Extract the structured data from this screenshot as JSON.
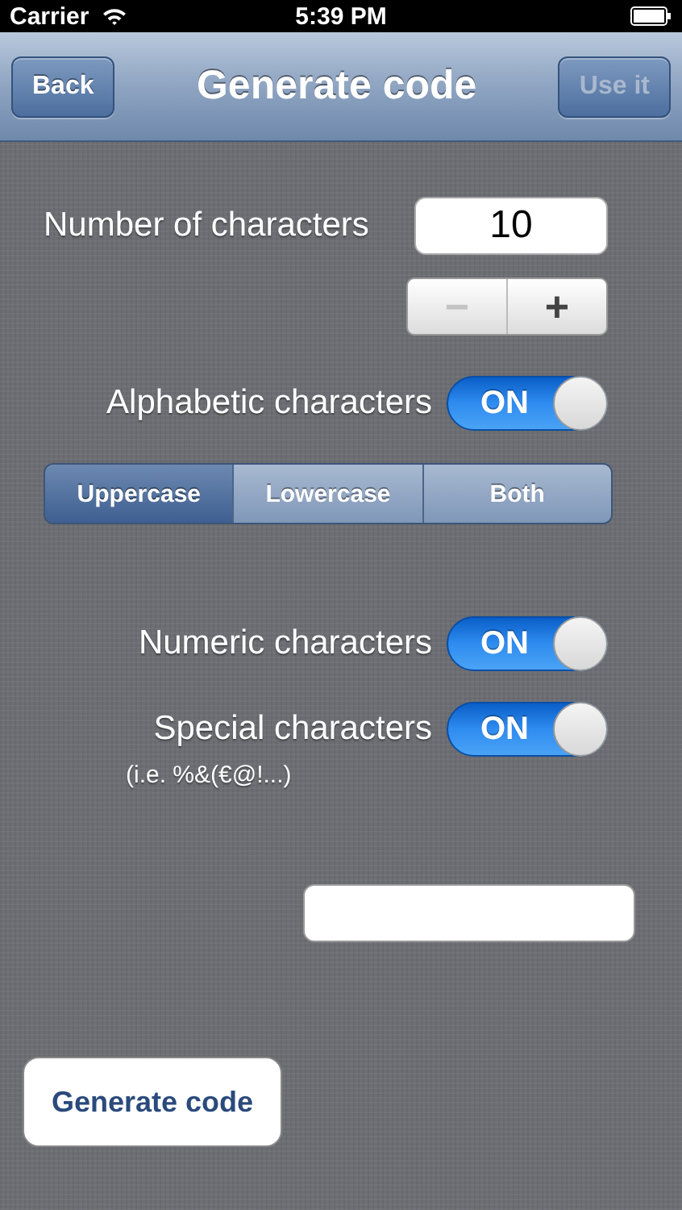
{
  "status_bar": {
    "carrier": "Carrier",
    "time": "5:39 PM"
  },
  "nav_bar": {
    "back": {
      "label": "Back",
      "disabled": false
    },
    "title": "Generate code",
    "action": {
      "label": "Use it",
      "disabled": true
    }
  },
  "length": {
    "label": "Number of characters",
    "value": "10",
    "stepper": [
      {
        "label": "−",
        "disabled": true
      },
      {
        "label": "+",
        "disabled": false
      }
    ]
  },
  "alphabetic": {
    "label": "Alphabetic characters",
    "on": true,
    "switch_text": "ON"
  },
  "case_options": [
    {
      "label": "Uppercase",
      "selected": true
    },
    {
      "label": "Lowercase",
      "selected": false
    },
    {
      "label": "Both",
      "selected": false
    }
  ],
  "numeric": {
    "label": "Numeric characters",
    "on": true,
    "switch_text": "ON"
  },
  "special": {
    "label": "Special characters",
    "on": true,
    "switch_text": "ON",
    "hint": "(i.e. %&(€@!...)"
  },
  "generate_button": {
    "label": "Generate code"
  }
}
